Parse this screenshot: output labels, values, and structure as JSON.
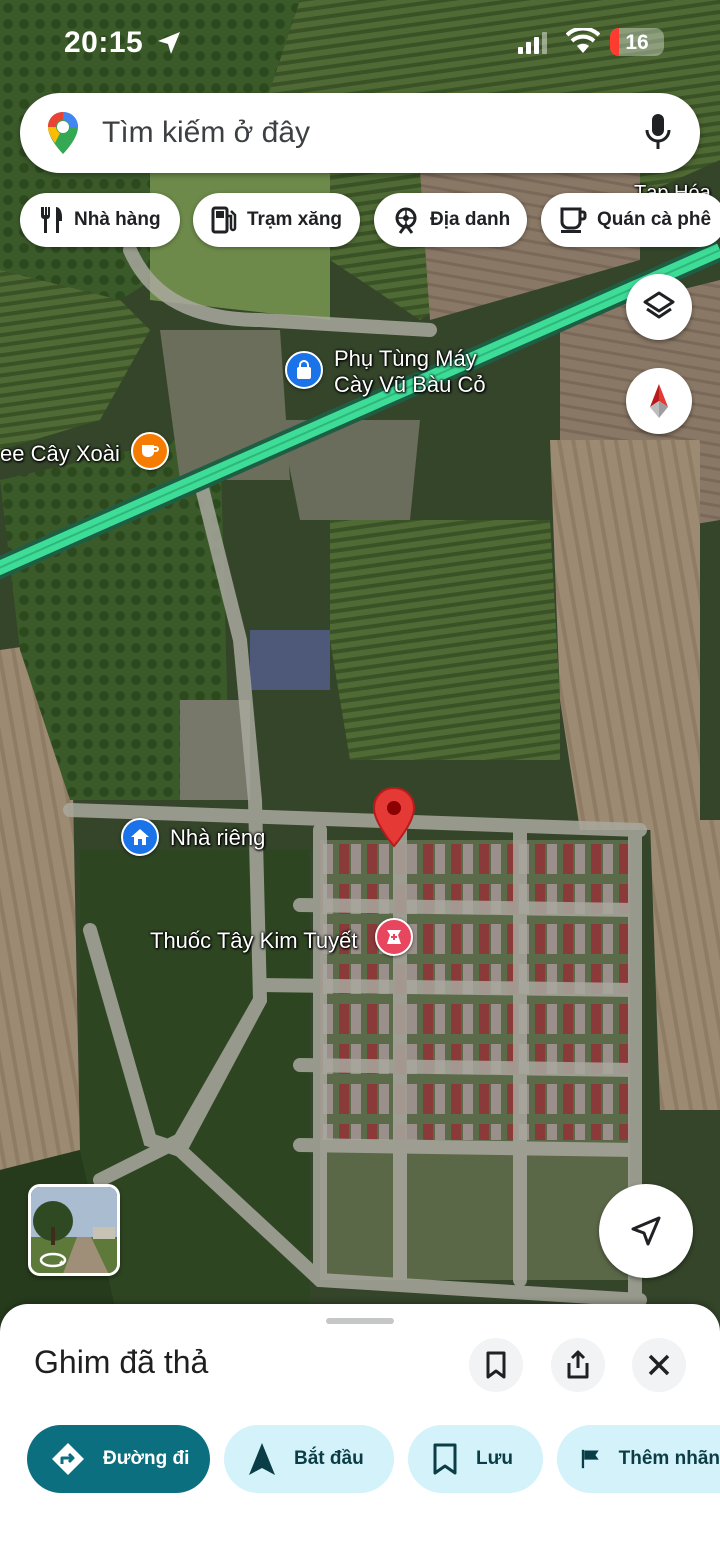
{
  "status_bar": {
    "time": "20:15",
    "battery": "16",
    "battery_color": "#ff3b30"
  },
  "search": {
    "placeholder": "Tìm kiếm ở đây"
  },
  "chips": [
    {
      "label": "Nhà hàng",
      "icon": "restaurant-icon"
    },
    {
      "label": "Trạm xăng",
      "icon": "gas-station-icon"
    },
    {
      "label": "Địa danh",
      "icon": "landmark-icon"
    },
    {
      "label": "Quán cà phê",
      "icon": "coffee-icon"
    }
  ],
  "map": {
    "labels": {
      "parts_shop_line1": "Phụ Tùng Máy",
      "parts_shop_line2": "Cày Vũ Bàu Cỏ",
      "coffee": "ee Cây Xoài",
      "home": "Nhà riêng",
      "pharmacy": "Thuốc Tây Kim Tuyết",
      "top_right": "Tạp Hóa"
    },
    "road_color": "#3ddc97",
    "pin_color": "#e53935"
  },
  "sheet": {
    "title": "Ghim đã thả",
    "actions": [
      {
        "label": "Đường đi",
        "icon": "directions-icon"
      },
      {
        "label": "Bắt đầu",
        "icon": "navigation-arrow-icon"
      },
      {
        "label": "Lưu",
        "icon": "bookmark-icon"
      },
      {
        "label": "Thêm nhãn",
        "icon": "flag-icon"
      }
    ]
  },
  "colors": {
    "accent": "#0b6f80",
    "chip_bg": "#d3f2fa"
  }
}
